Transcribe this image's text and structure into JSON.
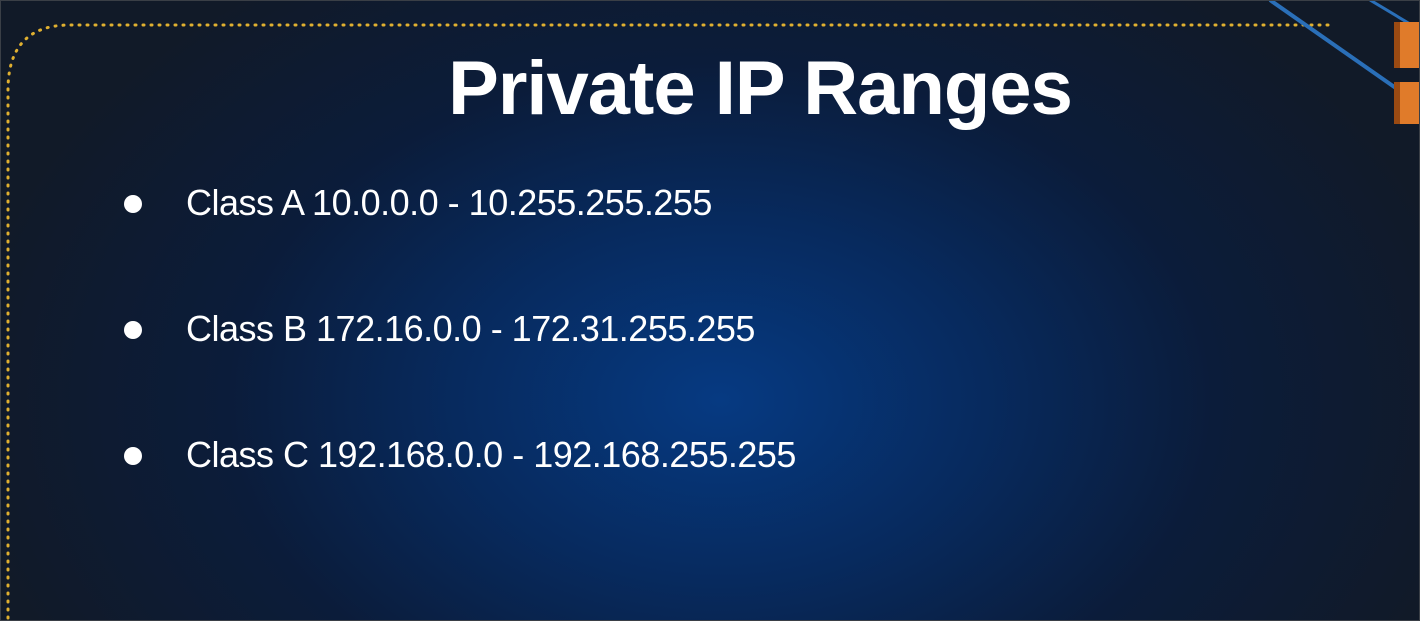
{
  "slide": {
    "title": "Private IP Ranges",
    "bullets": [
      {
        "text": "Class A 10.0.0.0 - 10.255.255.255"
      },
      {
        "text": "Class B 172.16.0.0 - 172.31.255.255"
      },
      {
        "text": "Class C 192.168.0.0 - 192.168.255.255"
      }
    ]
  },
  "colors": {
    "background_center": "#063a82",
    "background_edge": "#111a28",
    "text": "#ffffff",
    "dotted_border": "#e0b030",
    "accent_line": "#2a6fb8",
    "logo_orange": "#e07b2a"
  },
  "icons": {
    "corner_logo": "aws-logo-icon"
  }
}
